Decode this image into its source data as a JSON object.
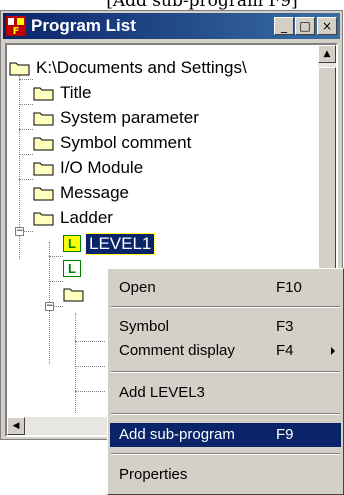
{
  "caption": "[Add sub-program F9]",
  "window": {
    "title": "Program List",
    "minimize_label": "_",
    "maximize_label": "□",
    "close_label": "×"
  },
  "tree": {
    "root": "K:\\Documents and Settings\\",
    "items": [
      "Title",
      "System parameter",
      "Symbol comment",
      "I/O Module",
      "Message",
      "Ladder"
    ],
    "ladder_children": [
      {
        "icon_text": "L",
        "label": "LEVEL1",
        "selected": true
      },
      {
        "icon_text": "L",
        "label": "",
        "selected": false
      }
    ],
    "expander_minus": "−"
  },
  "context_menu": {
    "items": [
      {
        "label": "Open",
        "shortcut": "F10"
      },
      {
        "label": "Symbol",
        "shortcut": "F3"
      },
      {
        "label": "Comment display",
        "shortcut": "F4"
      },
      {
        "label": "Add LEVEL3",
        "shortcut": ""
      },
      {
        "label": "Add sub-program",
        "shortcut": "F9"
      },
      {
        "label": "Properties",
        "shortcut": ""
      }
    ],
    "highlighted_index": 4,
    "submenu_arrow_icon": "triangle-right-icon"
  }
}
